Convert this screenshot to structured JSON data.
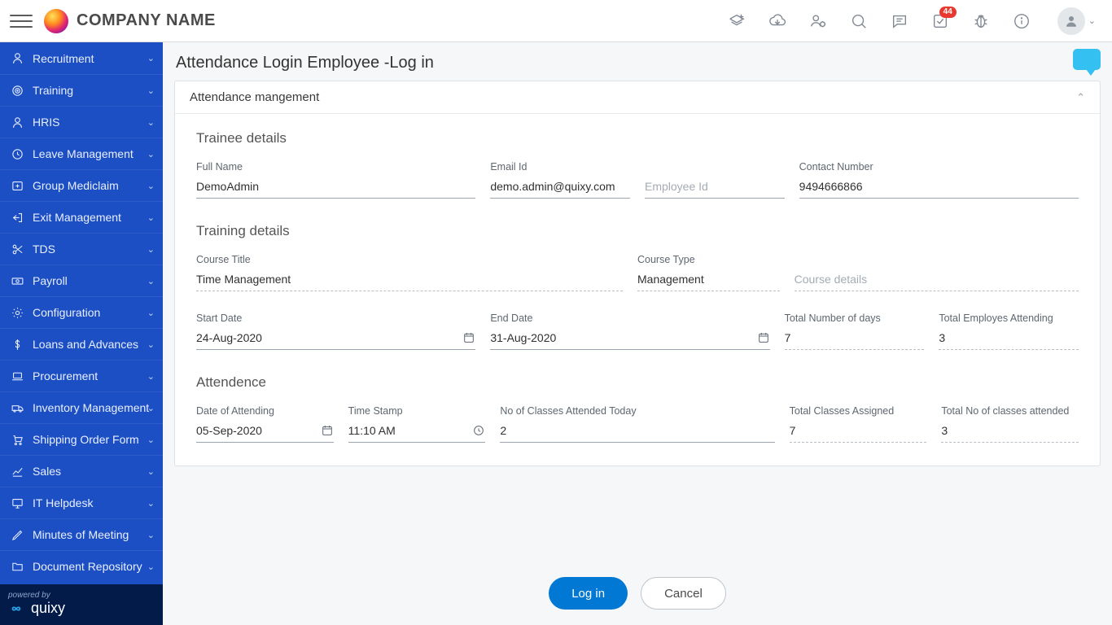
{
  "header": {
    "company_name": "COMPANY NAME",
    "notification_count": "44"
  },
  "sidebar": {
    "items": [
      {
        "label": "Recruitment"
      },
      {
        "label": "Training"
      },
      {
        "label": "HRIS"
      },
      {
        "label": "Leave Management"
      },
      {
        "label": "Group Mediclaim"
      },
      {
        "label": "Exit Management"
      },
      {
        "label": "TDS"
      },
      {
        "label": "Payroll"
      },
      {
        "label": "Configuration"
      },
      {
        "label": "Loans and Advances"
      },
      {
        "label": "Procurement"
      },
      {
        "label": "Inventory Management"
      },
      {
        "label": "Shipping Order Form"
      },
      {
        "label": "Sales"
      },
      {
        "label": "IT Helpdesk"
      },
      {
        "label": "Minutes of Meeting"
      },
      {
        "label": "Document Repository"
      }
    ],
    "powered_by": "powered by",
    "brand": "quixy"
  },
  "page": {
    "title": "Attendance Login Employee -Log in",
    "panel_title": "Attendance mangement",
    "section_trainee": "Trainee details",
    "section_training": "Training details",
    "section_attendance": "Attendence",
    "fields": {
      "full_name": {
        "label": "Full Name",
        "value": "DemoAdmin"
      },
      "email": {
        "label": "Email Id",
        "value": "demo.admin@quixy.com"
      },
      "employee_id": {
        "placeholder": "Employee Id"
      },
      "contact": {
        "label": "Contact Number",
        "value": "9494666866"
      },
      "course_title": {
        "label": "Course Title",
        "value": "Time Management"
      },
      "course_type": {
        "label": "Course Type",
        "value": "Management"
      },
      "course_details": {
        "placeholder": "Course details"
      },
      "start_date": {
        "label": "Start Date",
        "value": "24-Aug-2020"
      },
      "end_date": {
        "label": "End Date",
        "value": "31-Aug-2020"
      },
      "total_days": {
        "label": "Total Number of days",
        "value": "7"
      },
      "total_emp_attending": {
        "label": "Total Employes Attending",
        "value": "3"
      },
      "date_attending": {
        "label": "Date of Attending",
        "value": "05-Sep-2020"
      },
      "time_stamp": {
        "label": "Time Stamp",
        "value": "11:10 AM"
      },
      "classes_today": {
        "label": "No of Classes Attended Today",
        "value": "2"
      },
      "total_assigned": {
        "label": "Total Classes Assigned",
        "value": "7"
      },
      "total_attended": {
        "label": "Total No of classes attended",
        "value": "3"
      }
    }
  },
  "actions": {
    "login": "Log in",
    "cancel": "Cancel"
  }
}
